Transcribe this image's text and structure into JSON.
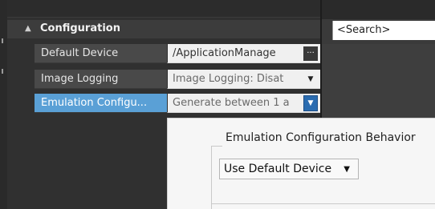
{
  "category": {
    "label": "Configuration",
    "expander_icon": "▲"
  },
  "properties": [
    {
      "name": "Default Device",
      "value": "/ApplicationManage",
      "control": "ellipsis-button",
      "control_glyph": "..."
    },
    {
      "name": "Image Logging",
      "value": "Image Logging: Disat",
      "control": "dropdown",
      "control_glyph": "▼"
    },
    {
      "name": "Emulation Configu...",
      "value": "Generate between 1 a",
      "control": "dropdown",
      "control_glyph": "▼",
      "selected": true
    }
  ],
  "search": {
    "placeholder": "<Search>"
  },
  "popup": {
    "group_title": "Emulation Configuration Behavior",
    "combo_value": "Use Default Device",
    "combo_arrow": "▼"
  },
  "colors": {
    "selection": "#5aa0d6",
    "dropdown_active": "#2b6cb0",
    "panel_bg": "#303030"
  }
}
